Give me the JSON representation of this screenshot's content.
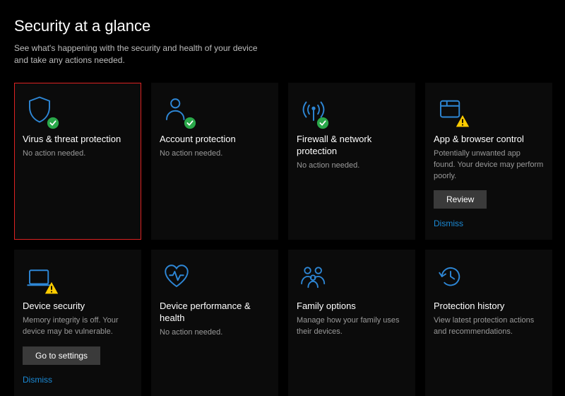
{
  "header": {
    "title": "Security at a glance",
    "subtitle": "See what's happening with the security and health of your device and take any actions needed."
  },
  "cards": {
    "virus": {
      "title": "Virus & threat protection",
      "desc": "No action needed."
    },
    "account": {
      "title": "Account protection",
      "desc": "No action needed."
    },
    "firewall": {
      "title": "Firewall & network protection",
      "desc": "No action needed."
    },
    "app_browser": {
      "title": "App & browser control",
      "desc": "Potentially unwanted app found. Your device may perform poorly.",
      "button": "Review",
      "dismiss": "Dismiss"
    },
    "device_security": {
      "title": "Device security",
      "desc": "Memory integrity is off. Your device may be vulnerable.",
      "button": "Go to settings",
      "dismiss": "Dismiss"
    },
    "performance": {
      "title": "Device performance & health",
      "desc": "No action needed."
    },
    "family": {
      "title": "Family options",
      "desc": "Manage how your family uses their devices."
    },
    "history": {
      "title": "Protection history",
      "desc": "View latest protection actions and recommendations."
    }
  },
  "colors": {
    "accent": "#2e87d6",
    "ok": "#2aa84a",
    "warn": "#ffcc00"
  }
}
